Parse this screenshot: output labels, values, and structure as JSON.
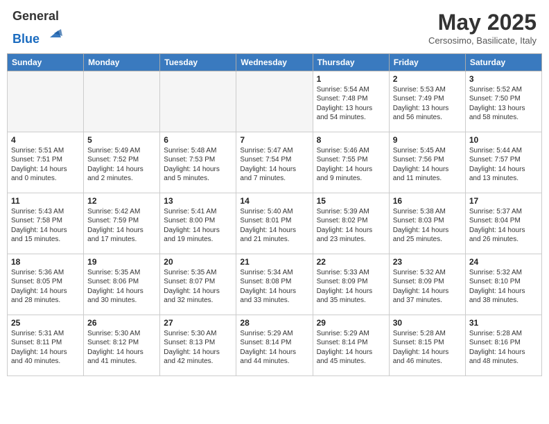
{
  "header": {
    "logo_line1": "General",
    "logo_line2": "Blue",
    "month_title": "May 2025",
    "subtitle": "Cersosimo, Basilicate, Italy"
  },
  "weekdays": [
    "Sunday",
    "Monday",
    "Tuesday",
    "Wednesday",
    "Thursday",
    "Friday",
    "Saturday"
  ],
  "weeks": [
    [
      {
        "day": "",
        "info": ""
      },
      {
        "day": "",
        "info": ""
      },
      {
        "day": "",
        "info": ""
      },
      {
        "day": "",
        "info": ""
      },
      {
        "day": "1",
        "info": "Sunrise: 5:54 AM\nSunset: 7:48 PM\nDaylight: 13 hours\nand 54 minutes."
      },
      {
        "day": "2",
        "info": "Sunrise: 5:53 AM\nSunset: 7:49 PM\nDaylight: 13 hours\nand 56 minutes."
      },
      {
        "day": "3",
        "info": "Sunrise: 5:52 AM\nSunset: 7:50 PM\nDaylight: 13 hours\nand 58 minutes."
      }
    ],
    [
      {
        "day": "4",
        "info": "Sunrise: 5:51 AM\nSunset: 7:51 PM\nDaylight: 14 hours\nand 0 minutes."
      },
      {
        "day": "5",
        "info": "Sunrise: 5:49 AM\nSunset: 7:52 PM\nDaylight: 14 hours\nand 2 minutes."
      },
      {
        "day": "6",
        "info": "Sunrise: 5:48 AM\nSunset: 7:53 PM\nDaylight: 14 hours\nand 5 minutes."
      },
      {
        "day": "7",
        "info": "Sunrise: 5:47 AM\nSunset: 7:54 PM\nDaylight: 14 hours\nand 7 minutes."
      },
      {
        "day": "8",
        "info": "Sunrise: 5:46 AM\nSunset: 7:55 PM\nDaylight: 14 hours\nand 9 minutes."
      },
      {
        "day": "9",
        "info": "Sunrise: 5:45 AM\nSunset: 7:56 PM\nDaylight: 14 hours\nand 11 minutes."
      },
      {
        "day": "10",
        "info": "Sunrise: 5:44 AM\nSunset: 7:57 PM\nDaylight: 14 hours\nand 13 minutes."
      }
    ],
    [
      {
        "day": "11",
        "info": "Sunrise: 5:43 AM\nSunset: 7:58 PM\nDaylight: 14 hours\nand 15 minutes."
      },
      {
        "day": "12",
        "info": "Sunrise: 5:42 AM\nSunset: 7:59 PM\nDaylight: 14 hours\nand 17 minutes."
      },
      {
        "day": "13",
        "info": "Sunrise: 5:41 AM\nSunset: 8:00 PM\nDaylight: 14 hours\nand 19 minutes."
      },
      {
        "day": "14",
        "info": "Sunrise: 5:40 AM\nSunset: 8:01 PM\nDaylight: 14 hours\nand 21 minutes."
      },
      {
        "day": "15",
        "info": "Sunrise: 5:39 AM\nSunset: 8:02 PM\nDaylight: 14 hours\nand 23 minutes."
      },
      {
        "day": "16",
        "info": "Sunrise: 5:38 AM\nSunset: 8:03 PM\nDaylight: 14 hours\nand 25 minutes."
      },
      {
        "day": "17",
        "info": "Sunrise: 5:37 AM\nSunset: 8:04 PM\nDaylight: 14 hours\nand 26 minutes."
      }
    ],
    [
      {
        "day": "18",
        "info": "Sunrise: 5:36 AM\nSunset: 8:05 PM\nDaylight: 14 hours\nand 28 minutes."
      },
      {
        "day": "19",
        "info": "Sunrise: 5:35 AM\nSunset: 8:06 PM\nDaylight: 14 hours\nand 30 minutes."
      },
      {
        "day": "20",
        "info": "Sunrise: 5:35 AM\nSunset: 8:07 PM\nDaylight: 14 hours\nand 32 minutes."
      },
      {
        "day": "21",
        "info": "Sunrise: 5:34 AM\nSunset: 8:08 PM\nDaylight: 14 hours\nand 33 minutes."
      },
      {
        "day": "22",
        "info": "Sunrise: 5:33 AM\nSunset: 8:09 PM\nDaylight: 14 hours\nand 35 minutes."
      },
      {
        "day": "23",
        "info": "Sunrise: 5:32 AM\nSunset: 8:09 PM\nDaylight: 14 hours\nand 37 minutes."
      },
      {
        "day": "24",
        "info": "Sunrise: 5:32 AM\nSunset: 8:10 PM\nDaylight: 14 hours\nand 38 minutes."
      }
    ],
    [
      {
        "day": "25",
        "info": "Sunrise: 5:31 AM\nSunset: 8:11 PM\nDaylight: 14 hours\nand 40 minutes."
      },
      {
        "day": "26",
        "info": "Sunrise: 5:30 AM\nSunset: 8:12 PM\nDaylight: 14 hours\nand 41 minutes."
      },
      {
        "day": "27",
        "info": "Sunrise: 5:30 AM\nSunset: 8:13 PM\nDaylight: 14 hours\nand 42 minutes."
      },
      {
        "day": "28",
        "info": "Sunrise: 5:29 AM\nSunset: 8:14 PM\nDaylight: 14 hours\nand 44 minutes."
      },
      {
        "day": "29",
        "info": "Sunrise: 5:29 AM\nSunset: 8:14 PM\nDaylight: 14 hours\nand 45 minutes."
      },
      {
        "day": "30",
        "info": "Sunrise: 5:28 AM\nSunset: 8:15 PM\nDaylight: 14 hours\nand 46 minutes."
      },
      {
        "day": "31",
        "info": "Sunrise: 5:28 AM\nSunset: 8:16 PM\nDaylight: 14 hours\nand 48 minutes."
      }
    ]
  ]
}
